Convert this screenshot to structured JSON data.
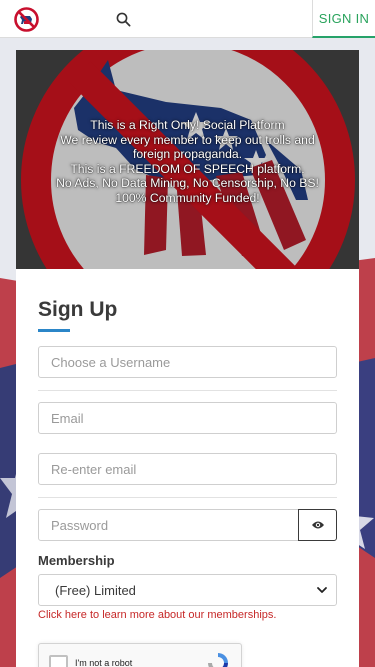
{
  "header": {
    "logo_icon": "no-donkey-logo-icon",
    "search_icon": "search-icon",
    "signin_label": "SIGN IN",
    "accent_color": "#29a35c"
  },
  "hero": {
    "lines": [
      "This is a Right Only! Social Platform",
      "We review every member to keep out trolls and",
      "foreign propaganda.",
      "This is a FREEDOM OF SPEECH platform.",
      "No Ads, No Data Mining, No Censorship, No BS!",
      "100% Community Funded!"
    ]
  },
  "form": {
    "title": "Sign Up",
    "title_underline_color": "#2b86c8",
    "username_placeholder": "Choose a Username",
    "email_placeholder": "Email",
    "reemail_placeholder": "Re-enter email",
    "password_placeholder": "Password",
    "password_toggle_icon": "eye-icon",
    "membership_label": "Membership",
    "membership_selected": "(Free) Limited",
    "membership_link": "Click here to learn more about our memberships.",
    "link_color": "#c62828",
    "captcha_label": "I'm not a robot"
  }
}
